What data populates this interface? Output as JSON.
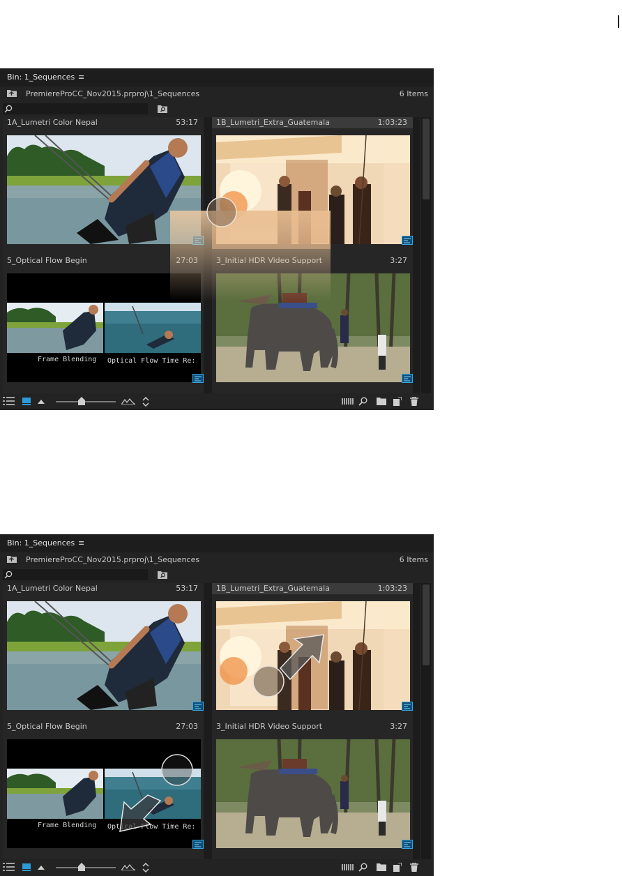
{
  "panels": [
    {
      "title": "Bin: 1_Sequences",
      "menu_glyph": "≡",
      "path": "PremiereProCC_Nov2015.prproj\\1_Sequences",
      "item_count": "6 Items",
      "search": {
        "value": "",
        "placeholder": ""
      },
      "clips": [
        {
          "name": "1A_Lumetri Color Nepal",
          "duration": "53:17"
        },
        {
          "name": "1B_Lumetri_Extra_Guatemala",
          "duration": "1:03:23"
        },
        {
          "name": "5_Optical Flow Begin",
          "duration": "27:03"
        },
        {
          "name": "3_Initial HDR Video Support",
          "duration": "3:27"
        }
      ],
      "frame_captions": {
        "left": "Frame Blending",
        "right": "Optical Flow Time Re:"
      },
      "zoom_level": 0.45
    },
    {
      "title": "Bin: 1_Sequences",
      "menu_glyph": "≡",
      "path": "PremiereProCC_Nov2015.prproj\\1_Sequences",
      "item_count": "6 Items",
      "search": {
        "value": "",
        "placeholder": ""
      },
      "clips": [
        {
          "name": "1A_Lumetri Color Nepal",
          "duration": "53:17"
        },
        {
          "name": "1B_Lumetri_Extra_Guatemala",
          "duration": "1:03:23"
        },
        {
          "name": "5_Optical Flow Begin",
          "duration": "27:03"
        },
        {
          "name": "3_Initial HDR Video Support",
          "duration": "3:27"
        }
      ],
      "frame_captions": {
        "left": "Frame Blending",
        "right": "Optical Flow Time Re:"
      },
      "zoom_level": 0.45
    }
  ],
  "icons": [
    "folder-up-icon",
    "search-icon",
    "new-search-bin-icon",
    "sequence-icon",
    "list-view-icon",
    "icon-view-icon",
    "zoom-small-icon",
    "zoom-large-icon",
    "sort-icon",
    "freeform-icon",
    "find-icon",
    "new-bin-icon",
    "new-item-icon",
    "trash-icon",
    "touch-circle-icon",
    "drag-arrow-icon"
  ],
  "colors": {
    "panel_bg": "#232323",
    "header_bg": "#1d1d1d",
    "accent": "#2d9ad8",
    "text": "#c8c8c8"
  }
}
